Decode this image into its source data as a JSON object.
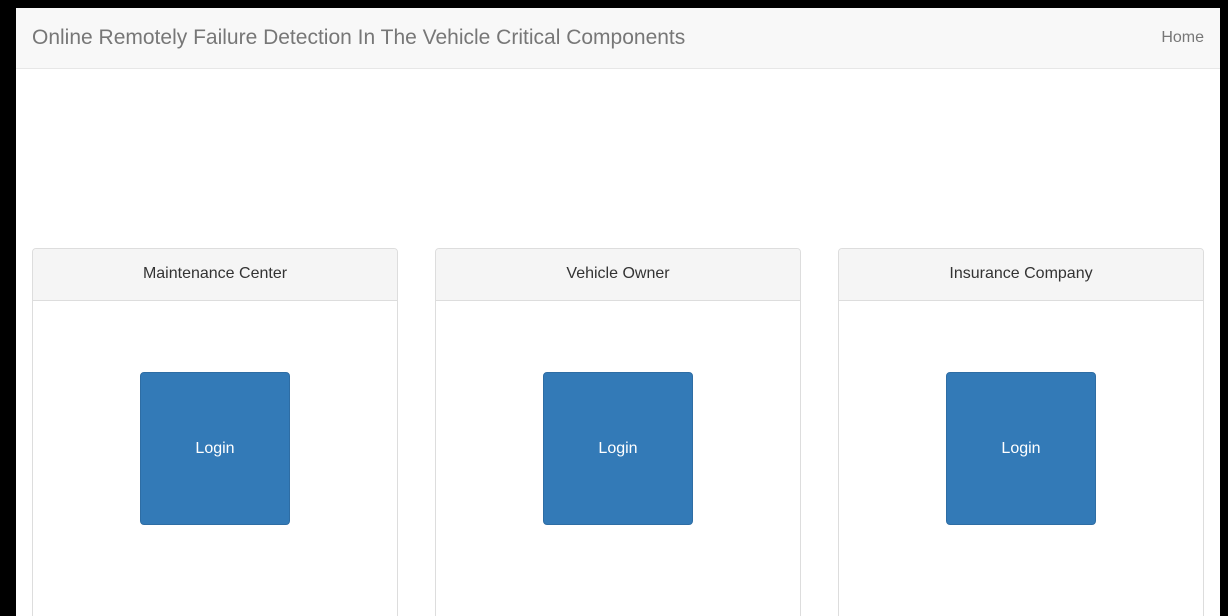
{
  "navbar": {
    "brand": "Online Remotely Failure Detection In The Vehicle Critical Components",
    "home_link": "Home"
  },
  "panels": [
    {
      "title": "Maintenance Center",
      "button_label": "Login"
    },
    {
      "title": "Vehicle Owner",
      "button_label": "Login"
    },
    {
      "title": "Insurance Company",
      "button_label": "Login"
    }
  ],
  "colors": {
    "button": "#337ab7",
    "navbar_bg": "#f8f8f8",
    "panel_heading_bg": "#f5f5f5"
  }
}
